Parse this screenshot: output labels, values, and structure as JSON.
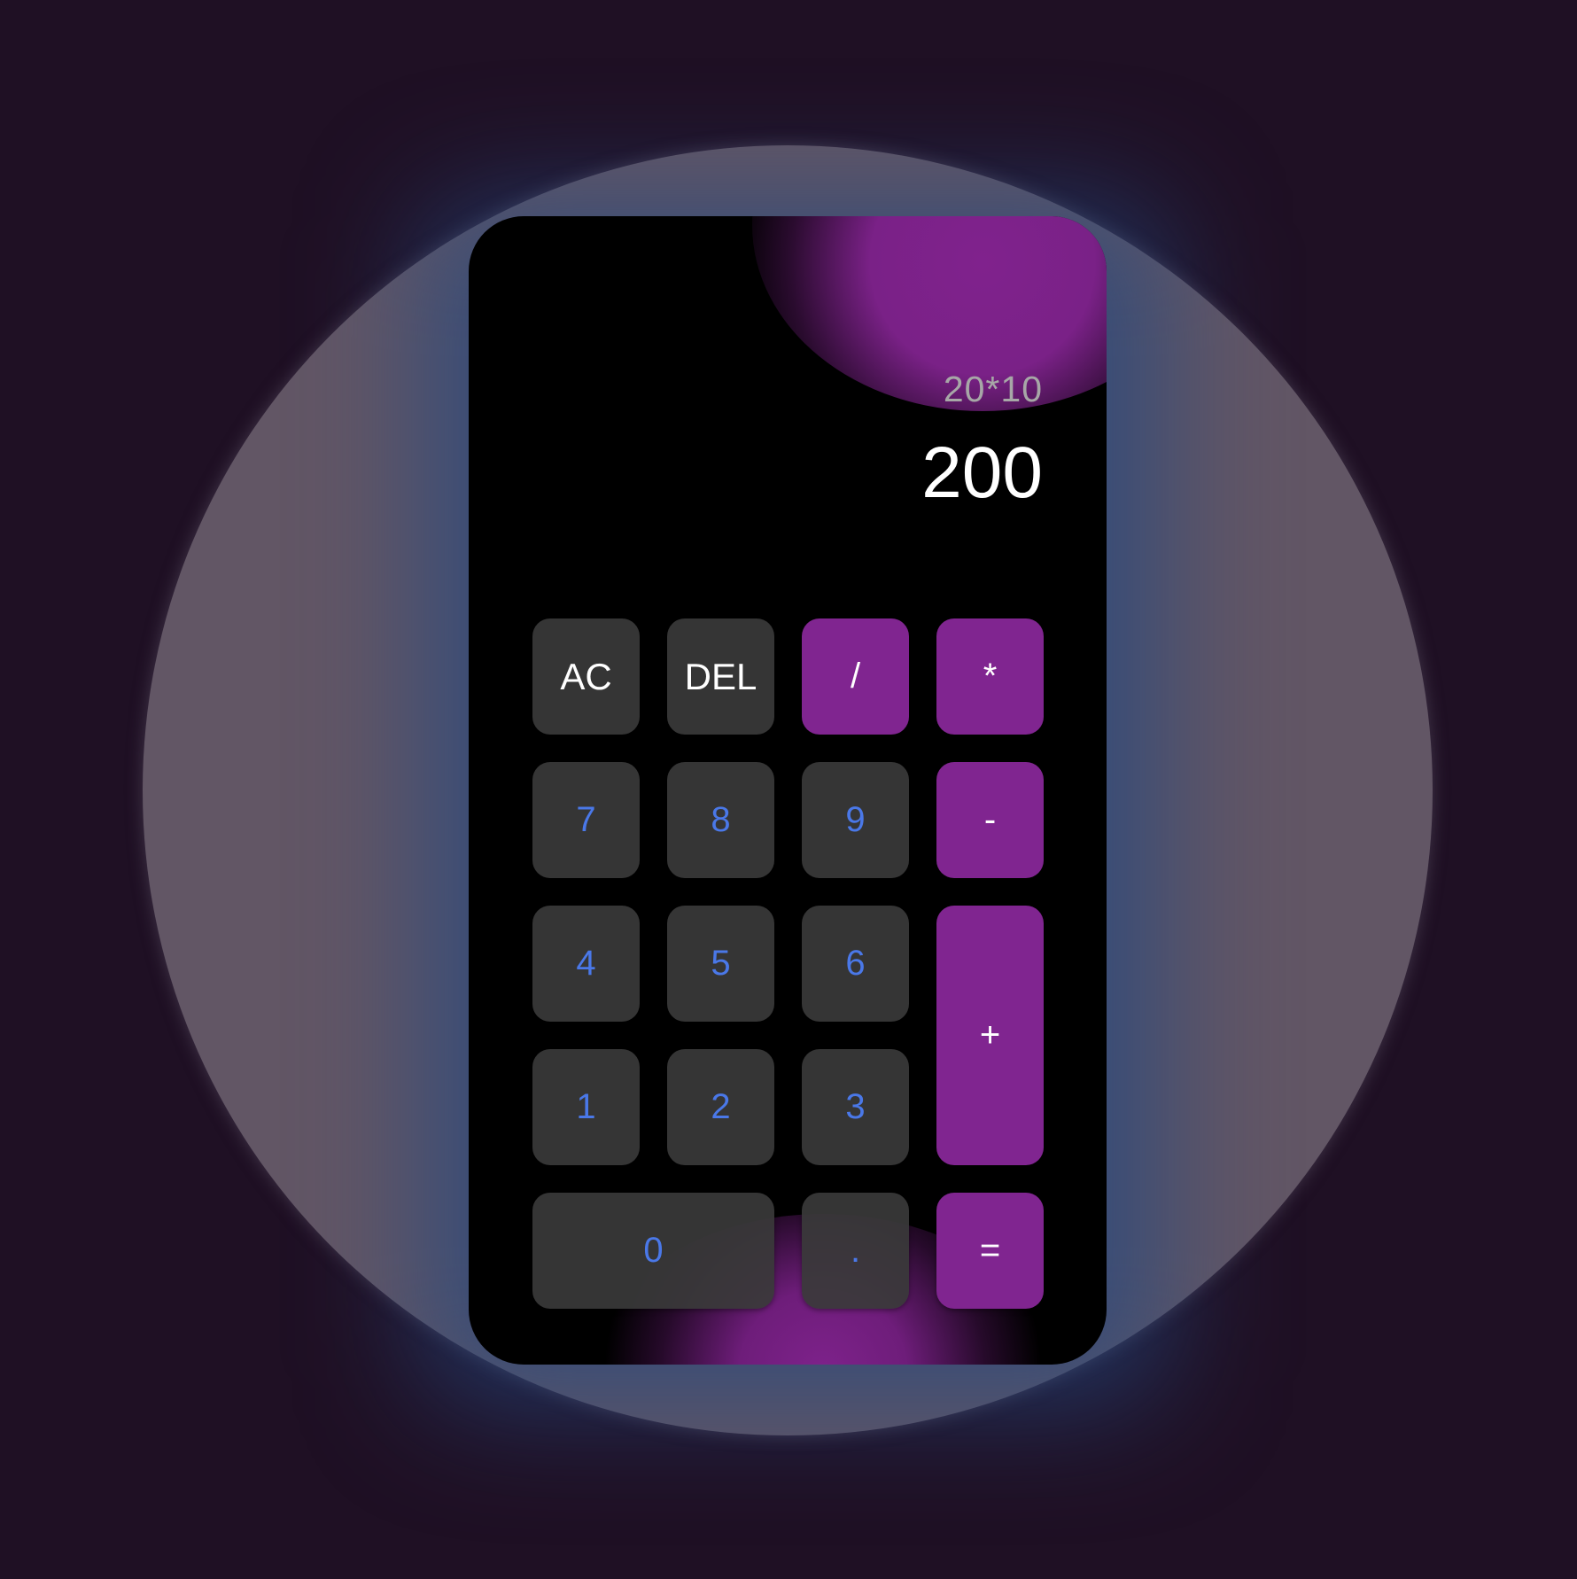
{
  "display": {
    "expression": "20*10",
    "result": "200"
  },
  "keys": {
    "ac": "AC",
    "del": "DEL",
    "divide": "/",
    "multiply": "*",
    "seven": "7",
    "eight": "8",
    "nine": "9",
    "minus": "-",
    "four": "4",
    "five": "5",
    "six": "6",
    "plus": "+",
    "one": "1",
    "two": "2",
    "three": "3",
    "zero": "0",
    "dot": ".",
    "equals": "="
  },
  "colors": {
    "page_background": "#1f1024",
    "halo": "#625665",
    "calculator_body": "#000000",
    "key_background": "#3a3a3a",
    "operator_key": "#802590",
    "digit_text": "#4a78e8",
    "expression_text": "#a7a7a7",
    "result_text": "#ffffff"
  }
}
